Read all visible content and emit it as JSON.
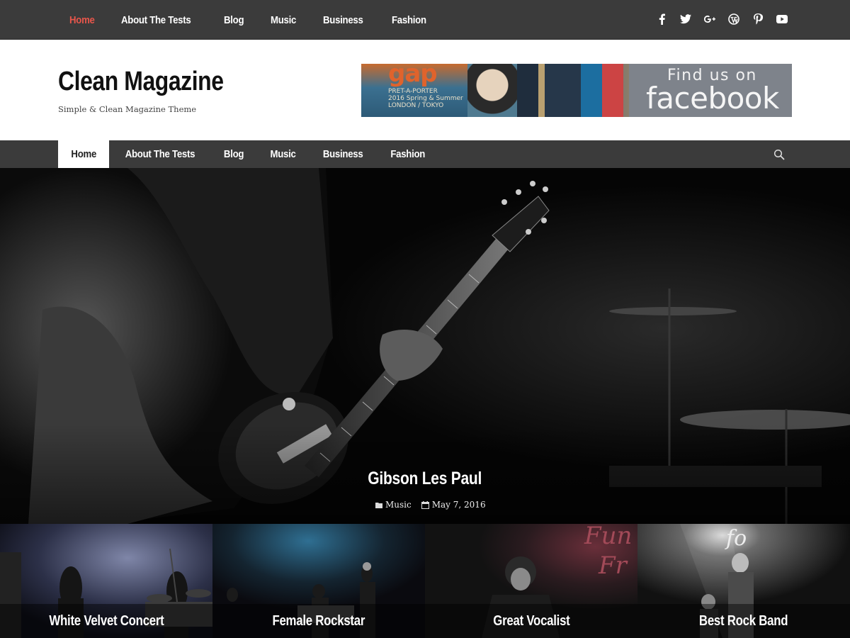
{
  "topbar": {
    "nav": [
      "Home",
      "About The Tests",
      "Blog",
      "Music",
      "Business",
      "Fashion"
    ],
    "social": [
      "facebook-icon",
      "twitter-icon",
      "google-plus-icon",
      "wordpress-icon",
      "pinterest-icon",
      "youtube-icon"
    ]
  },
  "header": {
    "title": "Clean Magazine",
    "description": "Simple & Clean Magazine Theme",
    "banner": {
      "magazine_title": "gap",
      "magazine_sub1": "PRET-A-PORTER",
      "magazine_sub2": "2016 Spring & Summer",
      "magazine_sub3": "LONDON / TOKYO",
      "find_text": "Find us on",
      "brand_text": "facebook"
    }
  },
  "mainnav": {
    "items": [
      "Home",
      "About The Tests",
      "Blog",
      "Music",
      "Business",
      "Fashion"
    ],
    "search_icon": "search-icon"
  },
  "hero": {
    "title": "Gibson Les Paul",
    "category": "Music",
    "date": "May 7, 2016"
  },
  "posts": [
    {
      "title": "White Velvet Concert"
    },
    {
      "title": "Female Rockstar"
    },
    {
      "title": "Great Vocalist"
    },
    {
      "title": "Best Rock Band"
    }
  ],
  "colors": {
    "accent": "#e8564b",
    "bar": "#3b3b3b",
    "header_bg": "#ffffff"
  }
}
